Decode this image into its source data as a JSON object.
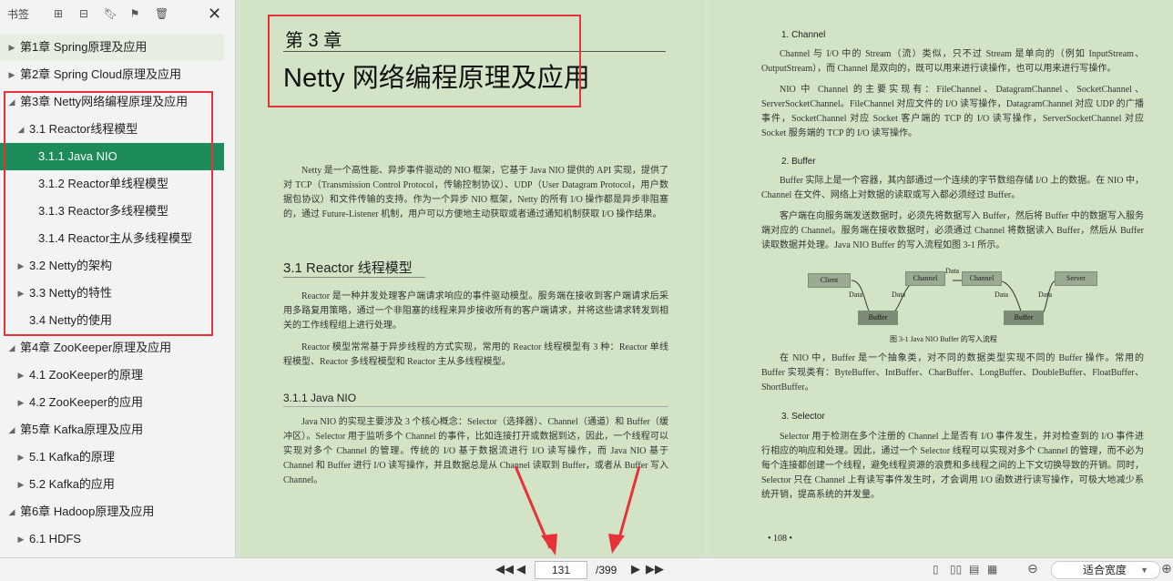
{
  "sidebar": {
    "title": "书签",
    "items": [
      {
        "label": "第1章 Spring原理及应用"
      },
      {
        "label": "第2章 Spring Cloud原理及应用"
      },
      {
        "label": "第3章 Netty网络编程原理及应用"
      },
      {
        "label": "3.1 Reactor线程模型"
      },
      {
        "label": "3.1.1 Java NIO"
      },
      {
        "label": "3.1.2 Reactor单线程模型"
      },
      {
        "label": "3.1.3 Reactor多线程模型"
      },
      {
        "label": "3.1.4 Reactor主从多线程模型"
      },
      {
        "label": "3.2 Netty的架构"
      },
      {
        "label": "3.3 Netty的特性"
      },
      {
        "label": "3.4 Netty的使用"
      },
      {
        "label": "第4章 ZooKeeper原理及应用"
      },
      {
        "label": "4.1 ZooKeeper的原理"
      },
      {
        "label": "4.2 ZooKeeper的应用"
      },
      {
        "label": "第5章 Kafka原理及应用"
      },
      {
        "label": "5.1 Kafka的原理"
      },
      {
        "label": "5.2 Kafka的应用"
      },
      {
        "label": "第6章 Hadoop原理及应用"
      },
      {
        "label": "6.1 HDFS"
      }
    ]
  },
  "left_page": {
    "chapter_small": "第 3 章",
    "chapter_title": "Netty 网络编程原理及应用",
    "intro": "Netty 是一个高性能、异步事件驱动的 NIO 框架，它基于 Java NIO 提供的 API 实现，提供了对 TCP（Transmission Control Protocol，传输控制协议）、UDP（User Datagram Protocol，用户数据包协议）和文件传输的支持。作为一个异步 NIO 框架，Netty 的所有 I/O 操作都是异步非阻塞的，通过 Future-Listener 机制，用户可以方便地主动获取或者通过通知机制获取 I/O 操作结果。",
    "sec31": "3.1    Reactor 线程模型",
    "sec31_p1": "Reactor 是一种并发处理客户端请求响应的事件驱动模型。服务端在接收到客户端请求后采用多路复用策略，通过一个非阻塞的线程来异步接收所有的客户端请求，并将这些请求转发到相关的工作线程组上进行处理。",
    "sec31_p2": "Reactor 模型常常基于异步线程的方式实现，常用的 Reactor 线程模型有 3 种：Reactor 单线程模型、Reactor 多线程模型和 Reactor 主从多线程模型。",
    "sec311": "3.1.1    Java NIO",
    "sec311_p1": "Java NIO 的实现主要涉及 3 个核心概念：Selector（选择器）、Channel（通道）和 Buffer（缓冲区）。Selector 用于监听多个 Channel 的事件，比如连接打开或数据到达，因此，一个线程可以实现对多个 Channel 的管理。传统的 I/O 基于数据流进行 I/O 读写操作，而 Java NIO 基于 Channel 和 Buffer 进行 I/O 读写操作，并且数据总是从 Channel 读取到 Buffer，或者从 Buffer 写入 Channel。"
  },
  "right_page": {
    "h1": "1. Channel",
    "p1": "Channel 与 I/O 中的 Stream（流）类似，只不过 Stream 是单向的（例如 InputStream、OutputStream），而 Channel 是双向的，既可以用来进行读操作，也可以用来进行写操作。",
    "p2": "NIO 中 Channel 的主要实现有：FileChannel、DatagramChannel、SocketChannel、ServerSocketChannel。FileChannel 对应文件的 I/O 读写操作，DatagramChannel 对应 UDP 的广播事件，SocketChannel 对应 Socket 客户端的 TCP 的 I/O 读写操作，ServerSocketChannel 对应 Socket 服务端的 TCP 的 I/O 读写操作。",
    "h2": "2. Buffer",
    "p3": "Buffer 实际上是一个容器，其内部通过一个连续的字节数组存储 I/O 上的数据。在 NIO 中，Channel 在文件、网络上对数据的读取或写入都必须经过 Buffer。",
    "p4": "客户端在向服务端发送数据时，必须先将数据写入 Buffer，然后将 Buffer 中的数据写入服务端对应的 Channel。服务端在接收数据时，必须通过 Channel 将数据读入 Buffer，然后从 Buffer 读取数据并处理。Java NIO Buffer 的写入流程如图 3-1 所示。",
    "diagram": {
      "client": "Client",
      "channel": "Channel",
      "server": "Server",
      "buffer": "Buffer",
      "data": "Data",
      "caption": "图 3-1    Java NIO Buffer 的写入流程"
    },
    "p5": "在 NIO 中，Buffer 是一个抽象类，对不同的数据类型实现不同的 Buffer 操作。常用的 Buffer 实现类有：ByteBuffer、IntBuffer、CharBuffer、LongBuffer、DoubleBuffer、FloatBuffer、ShortBuffer。",
    "h3": "3. Selector",
    "p6": "Selector 用于检测在多个注册的 Channel 上是否有 I/O 事件发生，并对检查到的 I/O 事件进行相应的响应和处理。因此，通过一个 Selector 线程可以实现对多个 Channel 的管理，而不必为每个连接都创建一个线程，避免线程资源的浪费和多线程之间的上下文切换导致的开销。同时，Selector 只在 Channel 上有读写事件发生时，才会调用 I/O 函数进行读写操作，可极大地减少系统开销，提高系统的并发量。",
    "page_num": "• 108 •"
  },
  "statusbar": {
    "page_current": "131",
    "page_total": "/399",
    "zoom_label": "适合宽度"
  },
  "colors": {
    "selected": "#1e8c5a",
    "highlight": "#e8323a",
    "page_bg": "#d3e3c6"
  },
  "icons": [
    "add-bookmark-icon",
    "remove-bookmark-icon",
    "bookmark-icon",
    "bookmark-edit-icon",
    "delete-icon",
    "close-icon",
    "first-page-icon",
    "prev-page-icon",
    "next-page-icon",
    "last-page-icon",
    "single-page-icon",
    "two-page-icon",
    "scroll-icon",
    "thumbnail-icon",
    "zoom-out-icon",
    "zoom-in-icon",
    "dropdown-icon"
  ]
}
